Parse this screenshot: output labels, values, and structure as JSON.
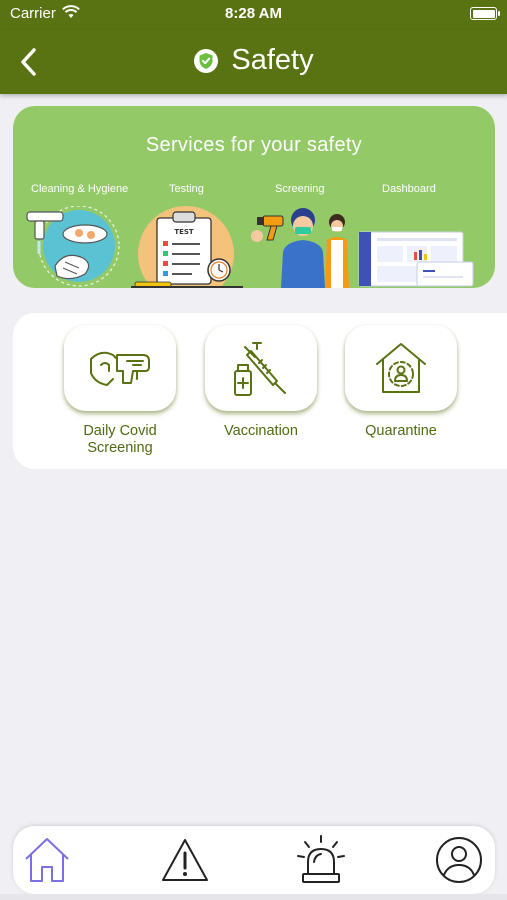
{
  "status_bar": {
    "carrier": "Carrier",
    "time": "8:28 AM"
  },
  "nav": {
    "title": "Safety",
    "back_icon": "chevron-left-icon",
    "title_icon": "shield-check-icon"
  },
  "banner": {
    "heading": "Services for your safety",
    "labels": [
      "Cleaning & Hygiene",
      "Testing",
      "Screening",
      "Dashboard"
    ],
    "test_sheet_text": "TEST"
  },
  "services": [
    {
      "label": "Daily Covid Screening",
      "icon": "thermometer-gun-icon"
    },
    {
      "label": "Vaccination",
      "icon": "syringe-vial-icon"
    },
    {
      "label": "Quarantine",
      "icon": "house-person-icon"
    }
  ],
  "tab_bar": {
    "items": [
      {
        "icon": "home-icon",
        "active": true
      },
      {
        "icon": "warning-icon",
        "active": false
      },
      {
        "icon": "alarm-light-icon",
        "active": false
      },
      {
        "icon": "profile-icon",
        "active": false
      }
    ]
  },
  "colors": {
    "header": "#5a7312",
    "banner": "#93c967",
    "accent_text": "#4f6b0f",
    "active_tab": "#7a70e0"
  }
}
